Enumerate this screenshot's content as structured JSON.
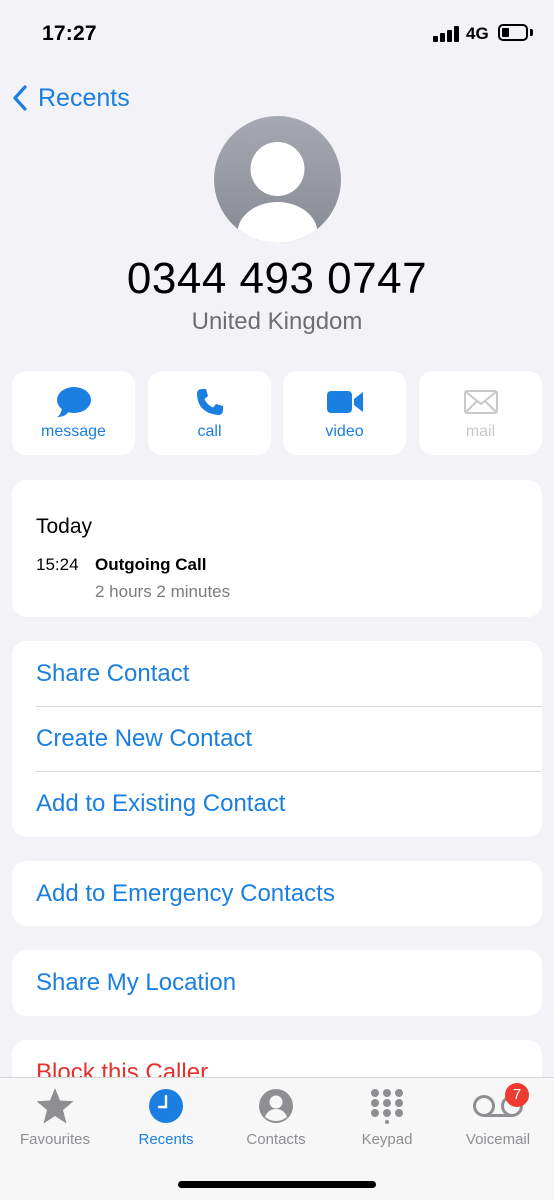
{
  "status_bar": {
    "time": "17:27",
    "network": "4G"
  },
  "nav": {
    "back_label": "Recents"
  },
  "contact": {
    "number": "0344 493 0747",
    "country": "United Kingdom"
  },
  "actions": [
    {
      "label": "message",
      "icon": "message-bubble-icon",
      "enabled": true
    },
    {
      "label": "call",
      "icon": "phone-icon",
      "enabled": true
    },
    {
      "label": "video",
      "icon": "video-camera-icon",
      "enabled": true
    },
    {
      "label": "mail",
      "icon": "envelope-icon",
      "enabled": false
    }
  ],
  "history": {
    "day": "Today",
    "time": "15:24",
    "type": "Outgoing Call",
    "duration": "2 hours 2 minutes"
  },
  "contact_options": [
    "Share Contact",
    "Create New Contact",
    "Add to Existing Contact"
  ],
  "emergency_option": "Add to Emergency Contacts",
  "location_option": "Share My Location",
  "block_option": "Block this Caller",
  "tabs": [
    {
      "label": "Favourites",
      "icon": "star-icon",
      "active": false
    },
    {
      "label": "Recents",
      "icon": "clock-icon",
      "active": true
    },
    {
      "label": "Contacts",
      "icon": "person-circle-icon",
      "active": false
    },
    {
      "label": "Keypad",
      "icon": "keypad-icon",
      "active": false
    },
    {
      "label": "Voicemail",
      "icon": "voicemail-icon",
      "active": false,
      "badge": "7"
    }
  ],
  "colors": {
    "accent": "#1a7fe0",
    "destructive": "#e5322d",
    "background": "#f2f2f7",
    "badge": "#ee3b30"
  }
}
